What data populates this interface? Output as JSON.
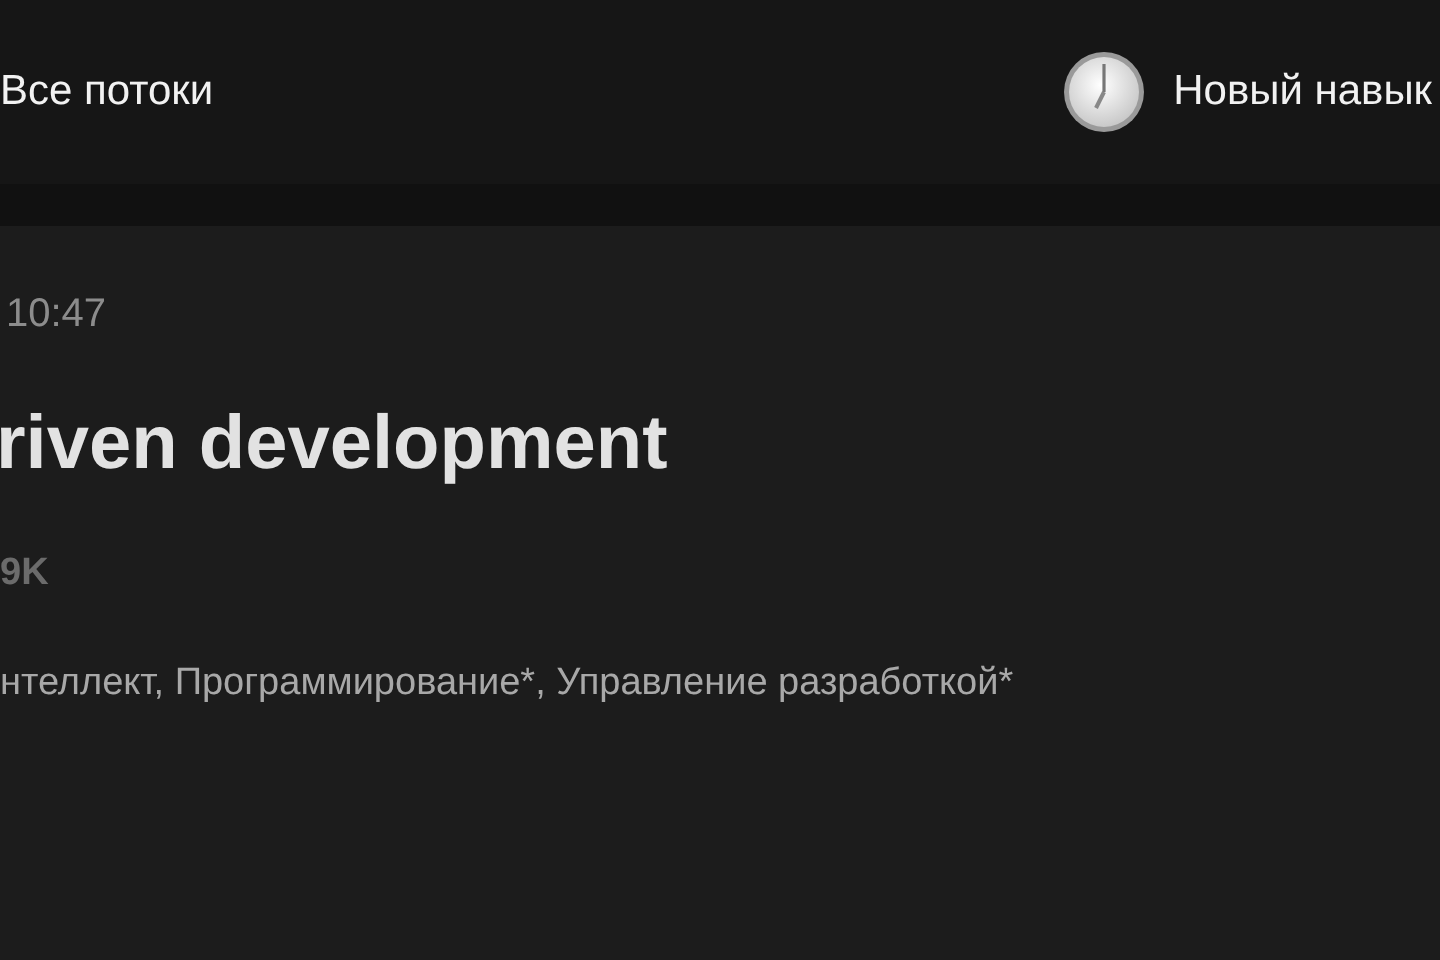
{
  "header": {
    "nav_link": "Все потоки",
    "action": "Новый навык"
  },
  "article": {
    "time": "10:47",
    "title": "riven development",
    "views": "9K",
    "hubs": "нтеллект, Программирование*, Управление разработкой*"
  }
}
